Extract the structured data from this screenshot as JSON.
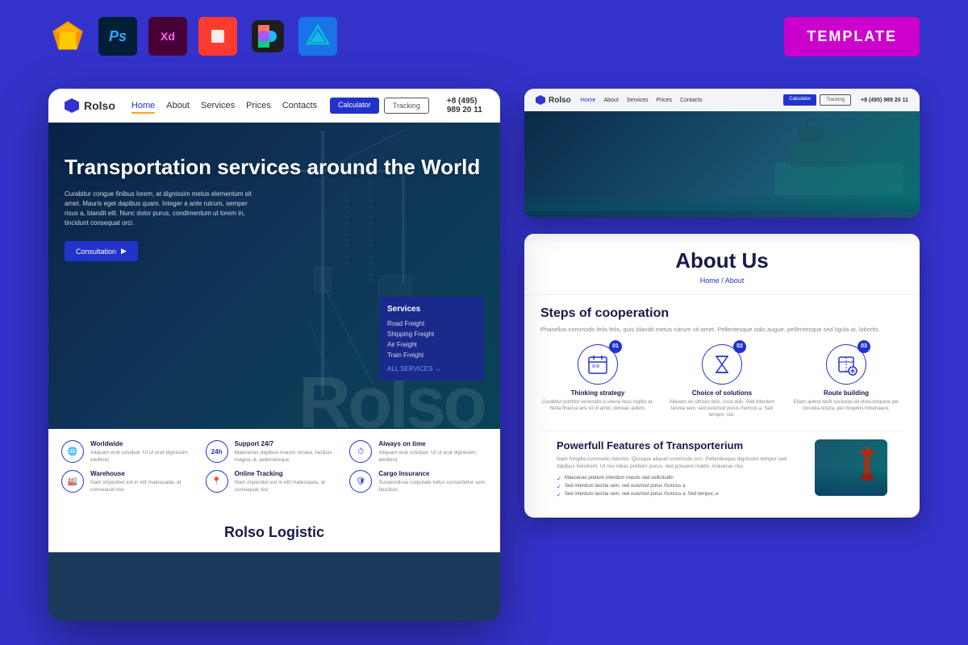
{
  "topbar": {
    "template_label": "TEMPLATE",
    "tools": [
      {
        "name": "Sketch",
        "type": "sketch"
      },
      {
        "name": "Photoshop",
        "type": "ps"
      },
      {
        "name": "Adobe XD",
        "type": "xd"
      },
      {
        "name": "Rectangle",
        "type": "rect"
      },
      {
        "name": "Figma",
        "type": "figma"
      },
      {
        "name": "Affinity",
        "type": "affinity"
      }
    ]
  },
  "left_mockup": {
    "brand": "Rolso",
    "nav_links": [
      "Home",
      "About",
      "Services",
      "Prices",
      "Contacts"
    ],
    "phone": "+8 (495) 989 20 11",
    "btn_calculator": "Calculator",
    "btn_tracking": "Tracking",
    "hero": {
      "title": "Transportation services around the World",
      "description": "Curabitur congue finibus lorem, at dignissim metus elementum sit amet. Mauris eget dapibus quam. Integer a ante rutrum, semper risus a, blandit elit. Nunc dolor purus, condimentum ut lorem in, tincidunt consequat orci.",
      "cta": "Consultation",
      "watermark": "Rolso"
    },
    "services_card": {
      "title": "Services",
      "items": [
        "Road Freight",
        "Shipping Freight",
        "Air Freight",
        "Train Freight"
      ],
      "all_link": "ALL SERVICES →"
    },
    "features": [
      {
        "icon": "🌐",
        "title": "Worldwide",
        "desc": "Aliquam erat volutpat. Ut ut erat dignissim, eleifend"
      },
      {
        "icon": "⏰",
        "title": "Support 24/7",
        "desc": "Maecenas dapibus mauris ornare, facilisis magna ut, pellentesque"
      },
      {
        "icon": "⏱",
        "title": "Always on time",
        "desc": "Aliquam erat volutpat. Ut ut erat dignissim, eleifend"
      },
      {
        "icon": "🏭",
        "title": "Warehouse",
        "desc": "Nam imperdiet est in elit malesuada, at consequat nisi"
      },
      {
        "icon": "📍",
        "title": "Online Tracking",
        "desc": "Nam imperdiet est in elit malesuada, at consequat nisi"
      },
      {
        "icon": "🛡",
        "title": "Cargo Insurance",
        "desc": "Suspendisse vulputate tellus consectetur sem faucibus"
      }
    ],
    "bottom_text": "Rolso Logistic"
  },
  "right_top": {
    "brand": "Rolso",
    "btn_calculator": "Calculator",
    "btn_tracking": "Tracking",
    "phone": "+8 (495) 989 20 11",
    "nav_links": [
      "Home",
      "About",
      "Services",
      "Prices",
      "Contacts"
    ]
  },
  "about_card": {
    "title": "About Us",
    "breadcrumb": "Home / About",
    "steps_title": "Steps of cooperation",
    "steps_desc": "Phasellus commodo felis felis, quis blandit metus rutrum sit amet. Pellentesque odio augue, pellentesque sed ligula at, lobortis.",
    "steps": [
      {
        "num": "01",
        "icon": "📅",
        "title": "Thinking strategy",
        "desc": "Curabitur porttitor venenatis a veena risus logitlis at. Nulla financa aris sit of amet, donean autem."
      },
      {
        "num": "02",
        "icon": "⏳",
        "title": "Choice of solutions",
        "desc": "Aliquam eu ultrices felis, risus duis. Sed interdum lacinia sem, sed euismod purus rhoncus a. Sed tempor, nisi."
      },
      {
        "num": "03",
        "icon": "📦",
        "title": "Route building",
        "desc": "Etiam aptent taciti sociosqu ad litora torquent per conubia nostra, per inceptos himenaeos."
      }
    ],
    "powerful_title": "Powerfull Features of Transporterium",
    "powerful_desc": "Nam fringilla commodo lobortis. Quisque aliquet commodo orci. Pellentesque dignissim tempor sed dapibus hendrerit. Ut nisi nibas pretium purus, sed posuere mattis, mauecas nisi.",
    "powerful_list": [
      "Maecenas pretium interdum mauris sed sollicitudin",
      "Sed interdum lacinia sem, sed euismod purus rhoncus a",
      "Sed interdum lacinia sem, sed euismod purus rhoncus a. Sed tempor, a"
    ]
  }
}
